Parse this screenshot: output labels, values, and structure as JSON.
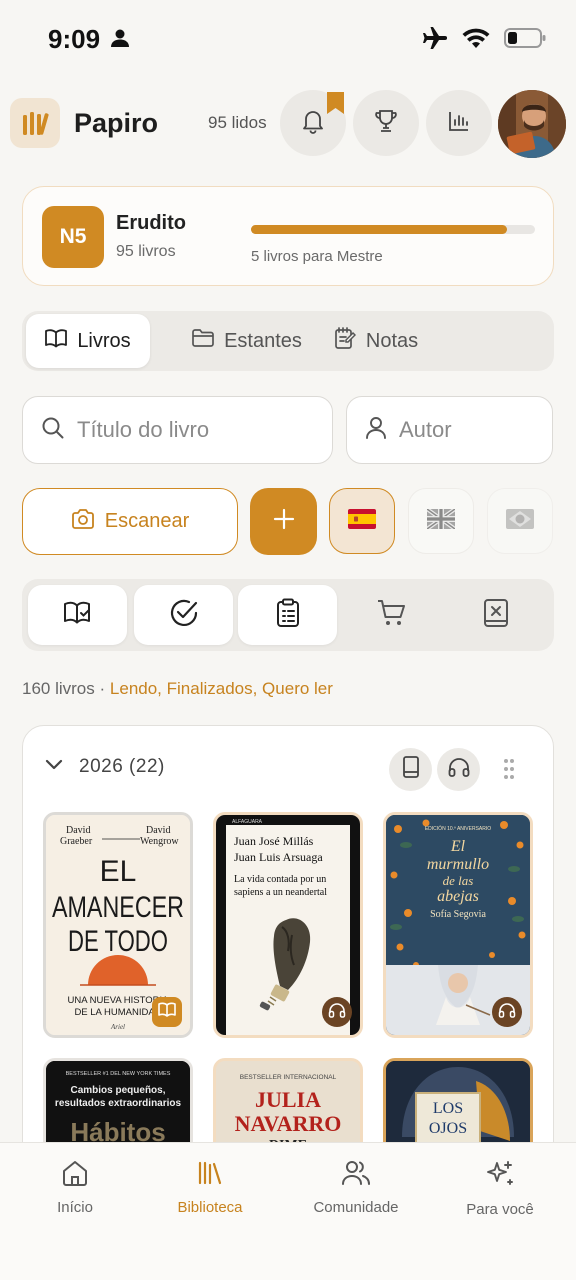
{
  "status_bar": {
    "time": "9:09"
  },
  "header": {
    "app_name": "Papiro",
    "read_count": "95 lidos"
  },
  "level": {
    "badge": "N5",
    "name": "Erudito",
    "books": "95 livros",
    "progress": 0.9,
    "next": "5 livros para Mestre"
  },
  "tabs": [
    {
      "label": "Livros",
      "icon": "book-open-icon",
      "active": true
    },
    {
      "label": "Estantes",
      "icon": "folder-icon",
      "active": false
    },
    {
      "label": "Notas",
      "icon": "notes-icon",
      "active": false
    }
  ],
  "search": {
    "title_placeholder": "Título do livro",
    "author_placeholder": "Autor"
  },
  "actions": {
    "scan_label": "Escanear",
    "add_label": "+",
    "languages": [
      "es",
      "gb",
      "br"
    ],
    "selected_language": "es"
  },
  "filters": [
    {
      "name": "reading",
      "icon": "book-check-icon",
      "active": true
    },
    {
      "name": "finished",
      "icon": "circle-check-icon",
      "active": true
    },
    {
      "name": "want-to-read",
      "icon": "clipboard-list-icon",
      "active": true
    },
    {
      "name": "wishlist",
      "icon": "cart-icon",
      "active": false
    },
    {
      "name": "abandoned",
      "icon": "book-x-icon",
      "active": false
    }
  ],
  "summary": {
    "count": "160 livros",
    "separator": "·",
    "filters": "Lendo, Finalizados, Quero ler"
  },
  "year_group": {
    "label": "2026 (22)",
    "books": [
      {
        "authors": "David Graeber — David Wengrow",
        "author_left": "David",
        "author_left2": "Graeber",
        "author_right": "David",
        "author_right2": "Wengrow",
        "title_line1": "EL",
        "title_line2": "AMANECER",
        "title_line3": "DE TODO",
        "subtitle1": "UNA NUEVA HISTORIA",
        "subtitle2": "DE LA HUMANIDAD",
        "publisher": "Ariel",
        "format": "ebook"
      },
      {
        "publisher_top": "ALFAGUARA",
        "author1": "Juan José Millás",
        "author2": "Juan Luis Arsuaga",
        "title1": "La vida contada por un",
        "title2": "sapiens a un neandertal",
        "format": "audio"
      },
      {
        "edition": "EDICIÓN 10.º ANIVERSARIO",
        "title1": "El",
        "title2": "murmullo",
        "title3": "de las",
        "title4": "abejas",
        "author": "Sofía Segovia",
        "format": "audio"
      },
      {
        "tagline": "BESTSELLER #1 DEL NEW YORK TIMES",
        "subtitle1": "Cambios pequeños,",
        "subtitle2": "resultados extraordinarios",
        "title": "Hábitos"
      },
      {
        "tagline": "BESTSELLER INTERNACIONAL",
        "author1": "JULIA",
        "author2": "NAVARRO",
        "title": "DIME"
      },
      {
        "title1": "LOS",
        "title2": "OJOS"
      }
    ]
  },
  "bottom_nav": [
    {
      "label": "Início",
      "icon": "home-icon",
      "active": false
    },
    {
      "label": "Biblioteca",
      "icon": "library-icon",
      "active": true
    },
    {
      "label": "Comunidade",
      "icon": "users-icon",
      "active": false
    },
    {
      "label": "Para você",
      "icon": "sparkles-icon",
      "active": false
    }
  ],
  "colors": {
    "accent": "#d08a23",
    "background": "#f7f6f3"
  }
}
